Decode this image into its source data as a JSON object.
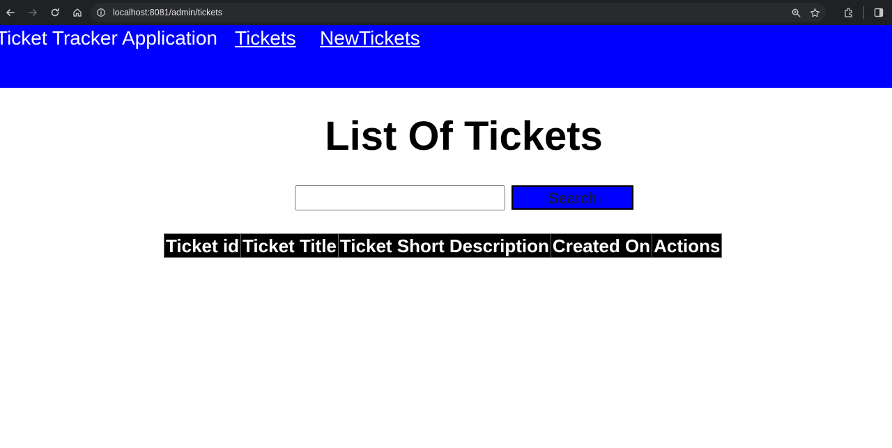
{
  "browser": {
    "url": "localhost:8081/admin/tickets"
  },
  "header": {
    "brand": "Ticket Tracker Application",
    "nav": [
      {
        "label": "Tickets"
      },
      {
        "label": "NewTickets"
      }
    ]
  },
  "main": {
    "title": "List Of Tickets",
    "search": {
      "value": "",
      "placeholder": "",
      "button_label": "Search"
    },
    "table": {
      "columns": [
        "Ticket id",
        "Ticket Title",
        "Ticket Short Description",
        "Created On",
        "Actions"
      ],
      "rows": []
    }
  },
  "colors": {
    "header_bg": "#0000ff",
    "button_bg": "#0000ff",
    "table_header_bg": "#000000"
  }
}
